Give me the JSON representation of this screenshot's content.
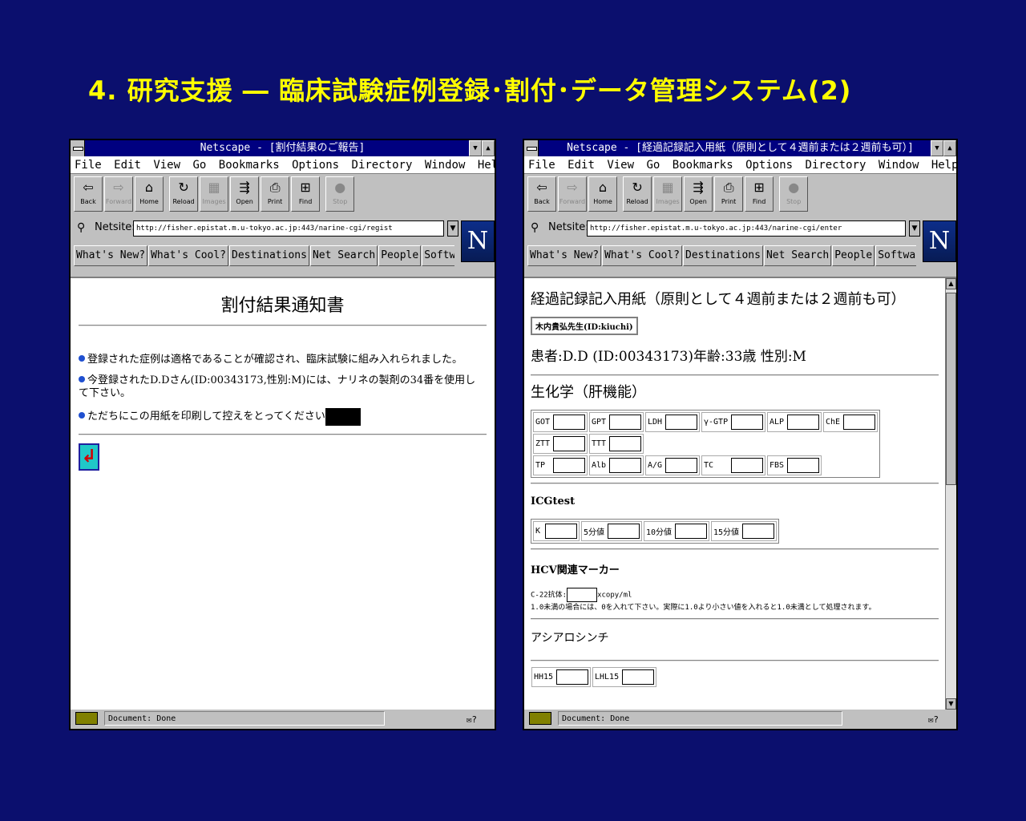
{
  "slide": {
    "title": "4. 研究支援 ― 臨床試験症例登録･割付･データ管理システム(2)"
  },
  "colors": {
    "background": "#0b0f6e",
    "title": "#ffff00",
    "titlebar": "#000080"
  },
  "menu": [
    "File",
    "Edit",
    "View",
    "Go",
    "Bookmarks",
    "Options",
    "Directory",
    "Window",
    "Help"
  ],
  "menu_left": [
    "File",
    "Edit",
    "View",
    "Go",
    "Bookmarks",
    "Options",
    "Directory",
    "Window",
    "Help"
  ],
  "toolbar": {
    "back": "Back",
    "forward": "Forward",
    "home": "Home",
    "reload": "Reload",
    "images": "Images",
    "open": "Open",
    "print": "Print",
    "find": "Find",
    "stop": "Stop"
  },
  "directory_buttons": [
    "What's New?",
    "What's Cool?",
    "Destinations",
    "Net Search",
    "People",
    "Software"
  ],
  "left_window": {
    "title": "Netscape - [割付結果のご報告]",
    "location_label": "Netsite:",
    "url": "http://fisher.epistat.m.u-tokyo.ac.jp:443/narine-cgi/regist",
    "heading": "割付結果通知書",
    "bullets": [
      "登録された症例は適格であることが確認され、臨床試験に組み入れられました。",
      "今登録されたD.Dさん(ID:00343173,性別:M)には、ナリネの製剤の34番を使用して下さい。",
      "ただちにこの用紙を印刷して控えをとってください"
    ],
    "status": "Document: Done"
  },
  "right_window": {
    "title": "Netscape - [経過記録記入用紙（原則として４週前または２週前も可）]",
    "location_label": "Netsite:",
    "url": "http://fisher.epistat.m.u-tokyo.ac.jp:443/narine-cgi/enter",
    "heading": "経過記録記入用紙（原則として４週前または２週前も可）",
    "doctor": "木内貴弘先生(ID:kiuchi)",
    "patient": "患者:D.D (ID:00343173)年齢:33歳 性別:M",
    "section_biochem": "生化学（肝機能）",
    "biochem_rows": [
      [
        "GOT",
        "GPT",
        "LDH",
        "γ-GTP",
        "ALP",
        "ChE"
      ],
      [
        "ZTT",
        "TTT"
      ],
      [
        "TP",
        "Alb",
        "A/G",
        "TC",
        "FBS"
      ]
    ],
    "section_icg": "ICGtest",
    "icg_fields": [
      "K",
      "5分値",
      "10分値",
      "15分値"
    ],
    "section_hcv": "HCV関連マーカー",
    "hcv_label": "C-22抗体:",
    "hcv_unit": "xcopy/ml",
    "hcv_note": "1.0未満の場合には、0を入れて下さい。実際に1.0より小さい値を入れると1.0未満として処理されます。",
    "section_asialo": "アシアロシンチ",
    "asialo_fields": [
      "HH15",
      "LHL15"
    ],
    "status": "Document: Done"
  }
}
